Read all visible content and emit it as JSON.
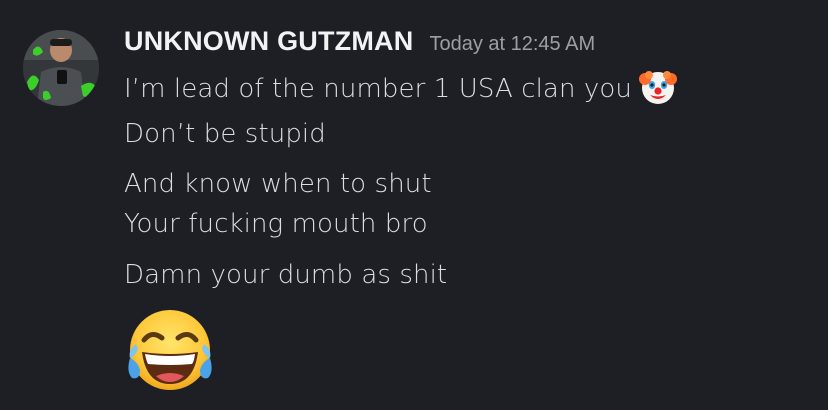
{
  "message": {
    "author": "UNKNOWN GUTZMAN",
    "timestamp": "Today at 12:45 AM",
    "lines": [
      "I’m lead of the number 1 USA clan you",
      "Don’t be stupid",
      "And know when to shut",
      "Your fucking mouth bro",
      "Damn your dumb as shit"
    ]
  },
  "icons": {
    "avatar": "user-avatar-photo",
    "inline_emoji": "clown-face-emoji",
    "large_emoji": "face-with-tears-of-joy-emoji"
  },
  "colors": {
    "background": "#1e1f24",
    "username": "#f2f3f5",
    "timestamp": "#9c9fa6",
    "message_text": "#dcdde1"
  }
}
